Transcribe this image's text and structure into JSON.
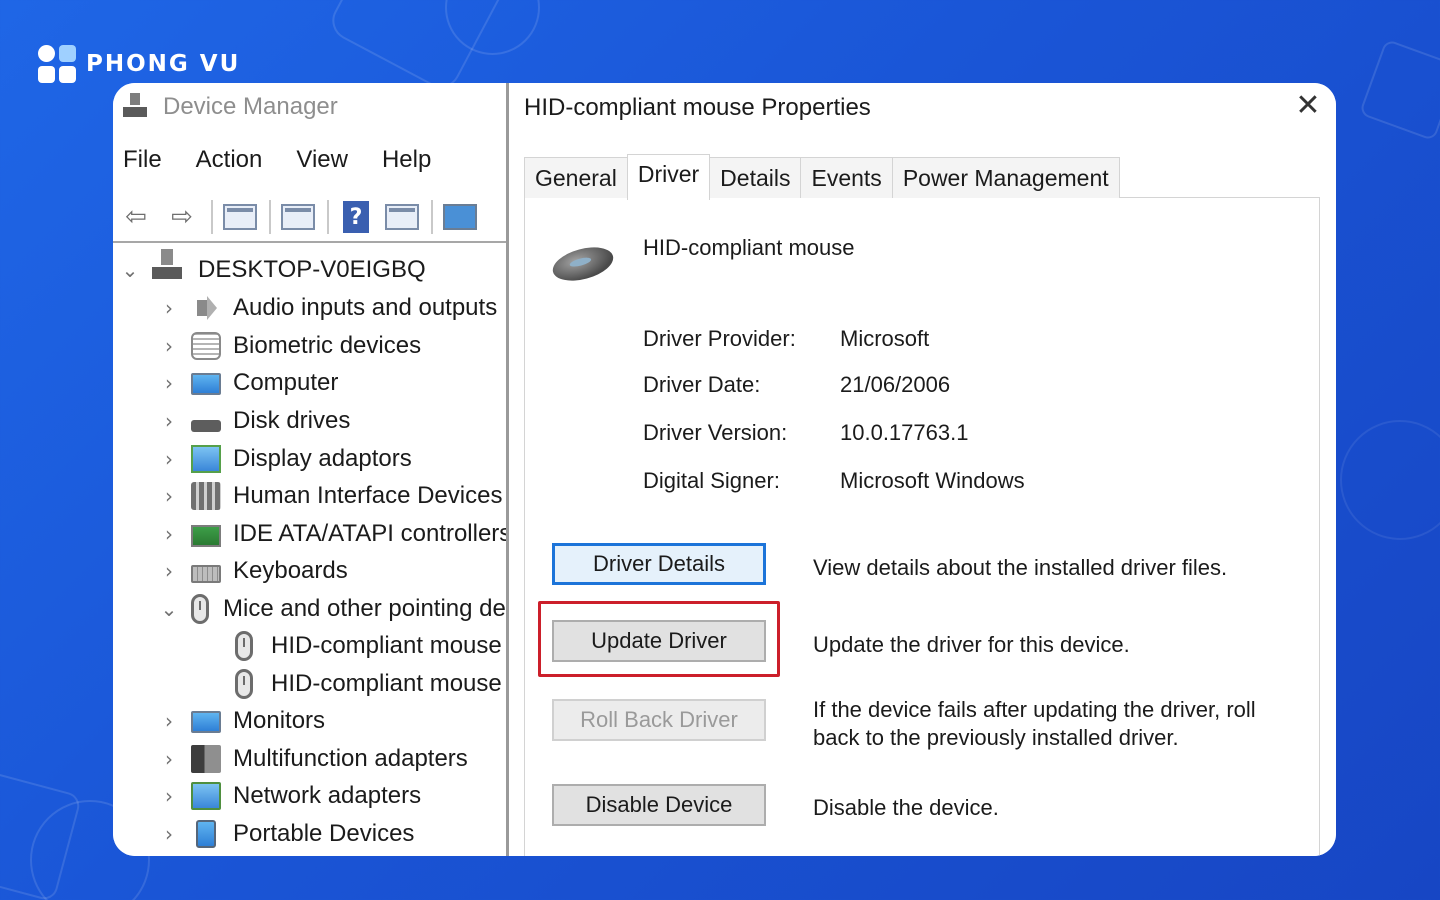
{
  "brand": {
    "name": "PHONG VU"
  },
  "device_manager": {
    "title": "Device Manager",
    "menu": [
      "File",
      "Action",
      "View",
      "Help"
    ],
    "toolbar": {
      "back_icon": "arrow-left-icon",
      "forward_icon": "arrow-right-icon",
      "help_glyph": "?"
    },
    "tree": {
      "root": "DESKTOP-V0EIGBQ",
      "items": [
        {
          "label": "Audio inputs and outputs",
          "icon": "speaker-icon",
          "expanded": false
        },
        {
          "label": "Biometric devices",
          "icon": "fingerprint-icon",
          "expanded": false
        },
        {
          "label": "Computer",
          "icon": "monitor-icon",
          "expanded": false
        },
        {
          "label": "Disk drives",
          "icon": "disk-drive-icon",
          "expanded": false
        },
        {
          "label": "Display adaptors",
          "icon": "display-adapter-icon",
          "expanded": false
        },
        {
          "label": "Human Interface Devices",
          "icon": "hid-icon",
          "expanded": false
        },
        {
          "label": "IDE ATA/ATAPI controllers",
          "icon": "ide-controller-icon",
          "expanded": false
        },
        {
          "label": "Keyboards",
          "icon": "keyboard-icon",
          "expanded": false
        },
        {
          "label": "Mice and other pointing devices",
          "icon": "mouse-icon",
          "expanded": true
        },
        {
          "label": "Monitors",
          "icon": "monitor-icon",
          "expanded": false
        },
        {
          "label": "Multifunction adapters",
          "icon": "multifunction-icon",
          "expanded": false
        },
        {
          "label": "Network adapters",
          "icon": "network-icon",
          "expanded": false
        },
        {
          "label": "Portable Devices",
          "icon": "portable-device-icon",
          "expanded": false
        }
      ],
      "mice_children": [
        "HID-compliant mouse",
        "HID-compliant mouse"
      ]
    }
  },
  "properties": {
    "title": "HID-compliant mouse Properties",
    "close_glyph": "✕",
    "tabs": [
      "General",
      "Driver",
      "Details",
      "Events",
      "Power Management"
    ],
    "active_tab": "Driver",
    "device_name": "HID-compliant mouse",
    "info": [
      {
        "label": "Driver Provider:",
        "value": "Microsoft"
      },
      {
        "label": "Driver Date:",
        "value": "21/06/2006"
      },
      {
        "label": "Driver Version:",
        "value": "10.0.17763.1"
      },
      {
        "label": "Digital Signer:",
        "value": "Microsoft Windows"
      }
    ],
    "actions": [
      {
        "label": "Driver Details",
        "description": "View details about the installed driver files.",
        "state": "focused"
      },
      {
        "label": "Update Driver",
        "description": "Update the driver for this device.",
        "state": "highlighted"
      },
      {
        "label": "Roll Back Driver",
        "description": "If the device fails after updating the driver, roll back to the previously installed driver.",
        "state": "disabled"
      },
      {
        "label": "Disable Device",
        "description": "Disable the device.",
        "state": "normal"
      }
    ],
    "highlight_color": "#cc1f2a",
    "focus_color": "#1c74d9"
  }
}
